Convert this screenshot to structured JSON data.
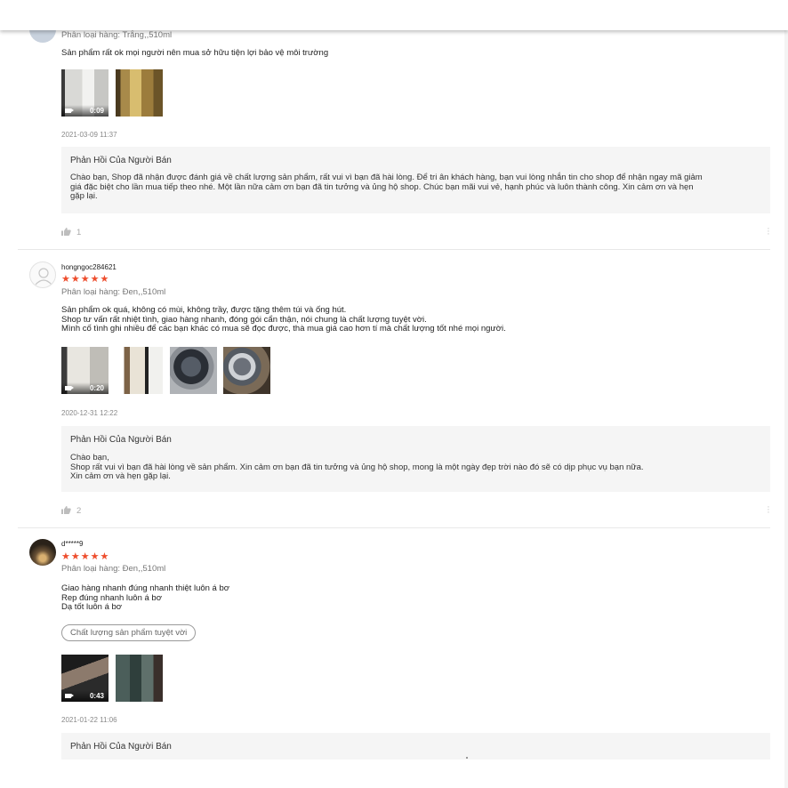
{
  "reviews": [
    {
      "variant": "Phân loại hàng: Trắng,,510ml",
      "content": [
        "Sản phẩm rất ok mọi người nên mua sở hữu tiện lợi bảo vệ môi trường"
      ],
      "video_duration": "0:09",
      "date": "2021-03-09 11:37",
      "reply_title": "Phản Hồi Của Người Bán",
      "reply_lines": [
        "Chào bạn, Shop đã nhận được đánh giá về chất lượng sản phẩm, rất vui vì bạn đã hài lòng. Để tri ân khách hàng, bạn vui lòng nhắn tin cho shop để nhận ngay mã giảm",
        "giá đặc biệt cho lần mua tiếp theo nhé. Một lần nữa cảm ơn bạn đã tin tưởng và ủng hộ shop. Chúc bạn mãi vui vẻ, hạnh phúc và luôn thành công. Xin cảm ơn và hẹn",
        "gặp lại."
      ],
      "likes": "1"
    },
    {
      "username": "hongngoc284621",
      "rating": "★★★★★",
      "variant": "Phân loại hàng: Đen,,510ml",
      "content": [
        "Sản phẩm ok quá, không có mùi, không trầy, được tặng thêm túi và ống hút.",
        "Shop tư vấn rất nhiệt tình, giao hàng nhanh, đóng gói cẩn thận, nói chung là chất lượng tuyệt vời.",
        "Mình cố tình ghi nhiều để các bạn khác có mua sẽ đọc được, thà mua giá cao hơn tí mà chất lượng tốt nhé mọi người."
      ],
      "video_duration": "0:20",
      "date": "2020-12-31 12:22",
      "reply_title": "Phản Hồi Của Người Bán",
      "reply_lines": [
        "Chào bạn,",
        "Shop rất vui vì bạn đã hài lòng về sản phẩm. Xin cảm ơn bạn đã tin tưởng và ủng hộ shop, mong là một ngày đẹp trời nào đó sẽ có dịp phục vụ bạn nữa.",
        "Xin cảm ơn và hẹn gặp lại."
      ],
      "likes": "2"
    },
    {
      "username": "d*****9",
      "rating": "★★★★★",
      "variant": "Phân loại hàng: Đen,,510ml",
      "content": [
        "Giao hàng nhanh đúng nhanh thiệt luôn á bơ",
        "Rep đúng nhanh luôn á bơ",
        "Dạ tốt luôn á bơ"
      ],
      "tag": "Chất lượng sản phẩm tuyệt vời",
      "video_duration": "0:43",
      "date": "2021-01-22 11:06",
      "reply_title": "Phản Hồi Của Người Bán"
    }
  ],
  "icons": {
    "like": "thumbs-up-icon",
    "more": "more-vertical-icon",
    "video": "video-camera-icon",
    "avatar_default": "user-icon"
  },
  "colors": {
    "star": "#ee4d2d",
    "reply_bg": "#f5f5f5"
  }
}
